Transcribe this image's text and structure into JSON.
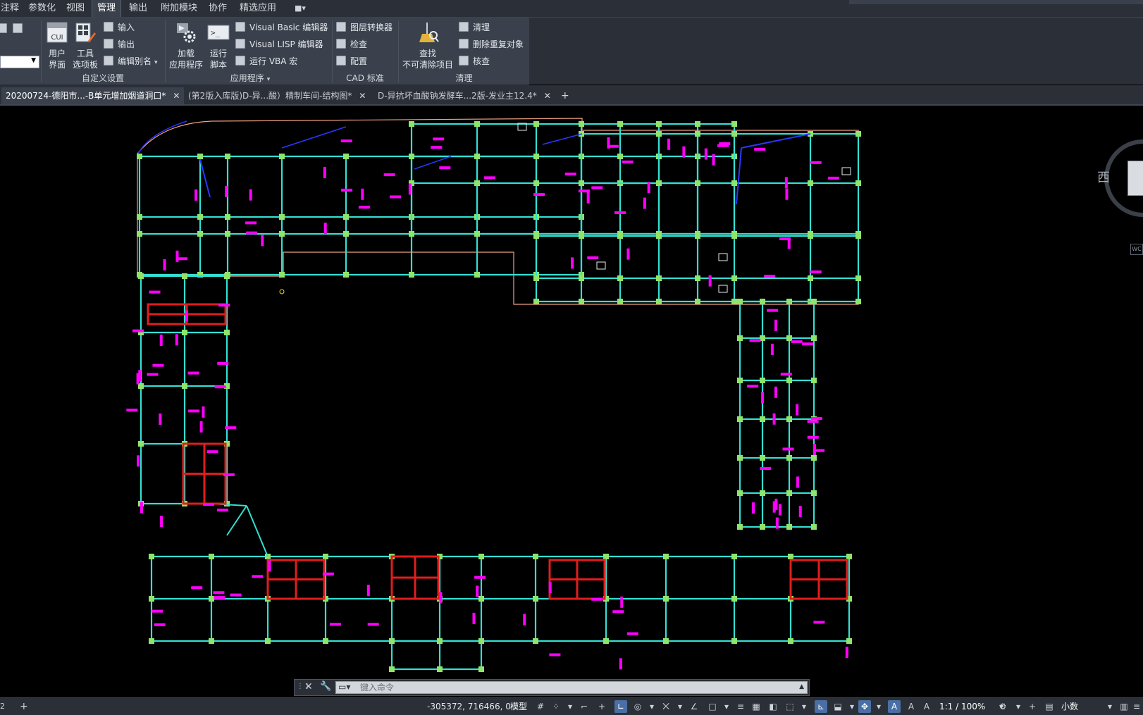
{
  "menubar": {
    "tabs": [
      "注释",
      "参数化",
      "视图",
      "管理",
      "输出",
      "附加模块",
      "协作",
      "精选应用"
    ],
    "active_tab": "管理"
  },
  "ribbon": {
    "customize": {
      "title": "自定义设置",
      "user_interface": "用户\n界面",
      "tool_palettes": "工具\n选项板",
      "import": "输入",
      "export": "输出",
      "edit_aliases": "编辑别名"
    },
    "applications": {
      "title": "应用程序",
      "load_app": "加载\n应用程序",
      "run_script": "运行\n脚本",
      "vba_editor": "Visual Basic 编辑器",
      "lisp_editor": "Visual LISP 编辑器",
      "run_vba": "运行 VBA 宏"
    },
    "cad_standards": {
      "title": "CAD 标准",
      "layer_translator": "图层转换器",
      "check": "检查",
      "configure": "配置"
    },
    "cleanup": {
      "title": "清理",
      "find_nonpurgeable": "查找\n不可清除项目",
      "purge": "清理",
      "overkill": "删除重复对象",
      "audit": "核查"
    }
  },
  "file_tabs": [
    {
      "label": "20200724-德阳市...-B单元增加烟道洞口*",
      "active": true
    },
    {
      "label": "(第2版入库版)D-异...酸）精制车间-结构图*",
      "active": false
    },
    {
      "label": "D-异抗坏血酸钠发酵车...2版-发业主12.4*",
      "active": false
    }
  ],
  "viewcube": {
    "west_label": "西",
    "wcs_label": "WC"
  },
  "command_line": {
    "placeholder": "键入命令"
  },
  "status_bar": {
    "layout_num": "2",
    "coordinates": "-305372, 716466, 0",
    "model_label": "模型",
    "scale": "1:1 / 100%",
    "units": "小数"
  },
  "colors": {
    "beam": "#32e0d2",
    "column": "#8fe46a",
    "outline": "#f0a080",
    "text_magenta": "#ff00ff",
    "red_wall": "#e11d1d",
    "blue_line": "#2b37ff",
    "ribbon_bg": "#3a414c"
  }
}
